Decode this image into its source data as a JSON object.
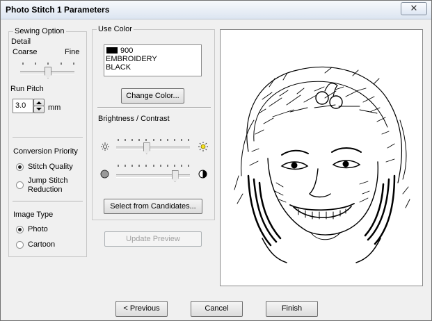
{
  "window": {
    "title": "Photo Stitch 1 Parameters",
    "close_glyph": "✕"
  },
  "sewing_option": {
    "group_label": "Sewing Option",
    "detail_label": "Detail",
    "coarse_label": "Coarse",
    "fine_label": "Fine",
    "detail_level": 0.5,
    "run_pitch_label": "Run Pitch",
    "run_pitch_value": "3.0",
    "run_pitch_unit": "mm"
  },
  "conversion_priority": {
    "label": "Conversion Priority",
    "options": [
      {
        "label": "Stitch Quality",
        "selected": true
      },
      {
        "label": "Jump Stitch\nReduction",
        "selected": false
      }
    ]
  },
  "image_type": {
    "label": "Image Type",
    "options": [
      {
        "label": "Photo",
        "selected": true
      },
      {
        "label": "Cartoon",
        "selected": false
      }
    ]
  },
  "use_color": {
    "group_label": "Use Color",
    "color_code": "900",
    "color_line2": "EMBROIDERY",
    "color_line3": "BLACK",
    "swatch_color": "#000000",
    "change_color_button": "Change Color..."
  },
  "brightness_contrast": {
    "label": "Brightness / Contrast",
    "brightness_level": 0.4,
    "contrast_level": 0.8,
    "icons": [
      "brightness-low-icon",
      "brightness-high-icon",
      "contrast-low-icon",
      "contrast-high-icon"
    ],
    "select_candidates_button": "Select from Candidates..."
  },
  "update_preview_button": "Update Preview",
  "footer": {
    "previous_button": "< Previous",
    "cancel_button": "Cancel",
    "finish_button": "Finish"
  }
}
